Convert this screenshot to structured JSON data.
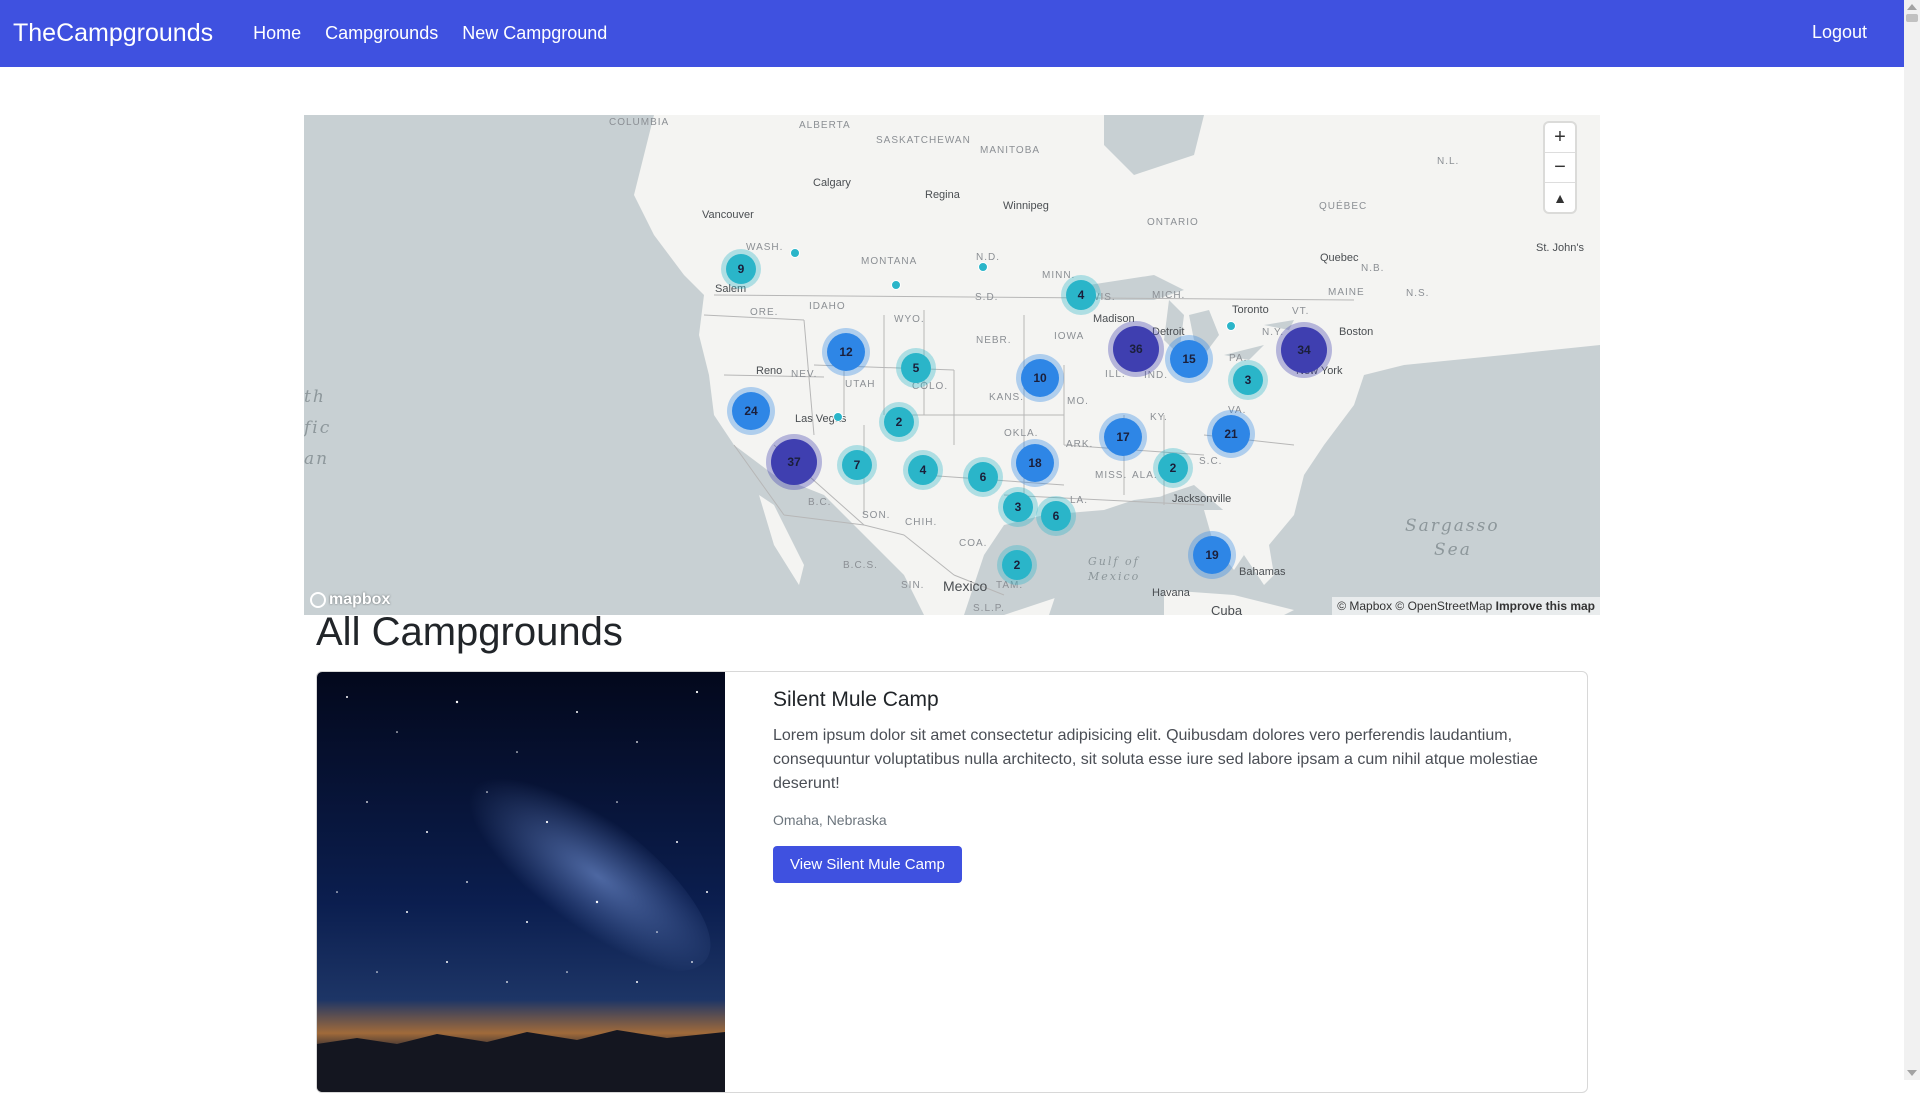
{
  "nav": {
    "brand": "TheCampgrounds",
    "links": [
      "Home",
      "Campgrounds",
      "New Campground"
    ],
    "logout": "Logout"
  },
  "map": {
    "region_labels": [
      "COLUMBIA",
      "ALBERTA",
      "SASKATCHEWAN",
      "MANITOBA",
      "ONTARIO",
      "QUÉBEC",
      "N.L.",
      "WASH.",
      "MONTANA",
      "N.D.",
      "MINN.",
      "ORE.",
      "IDAHO",
      "WYO.",
      "S.D.",
      "WIS.",
      "MICH.",
      "NEBR.",
      "IOWA",
      "NEV.",
      "UTAH",
      "COLO.",
      "KANS.",
      "MO.",
      "ILL.",
      "IND.",
      "PA.",
      "N.Y.",
      "VT.",
      "MAINE",
      "N.B.",
      "N.S.",
      "OKLA.",
      "ARK.",
      "KY.",
      "VA.",
      "MISS.",
      "ALA.",
      "S.C.",
      "LA.",
      "SON.",
      "CHIH.",
      "COA.",
      "B.C.",
      "B.C.S.",
      "SIN.",
      "TAM.",
      "S.L.P."
    ],
    "city_labels": [
      "Calgary",
      "Regina",
      "Winnipeg",
      "Vancouver",
      "Salem",
      "Quebec",
      "St. John's",
      "Toronto",
      "Detroit",
      "Madison",
      "Boston",
      "New York",
      "Reno",
      "Las Vegas",
      "Jacksonville",
      "Bahamas",
      "Havana",
      "Cuba",
      "Mexico"
    ],
    "ocean_labels": [
      "th",
      "fic",
      "an",
      "Sargasso",
      "Sea",
      "Gulf of",
      "Mexico"
    ],
    "clusters": [
      "9",
      "4",
      "12",
      "5",
      "36",
      "15",
      "34",
      "10",
      "3",
      "24",
      "2",
      "17",
      "21",
      "37",
      "7",
      "4",
      "6",
      "18",
      "2",
      "3",
      "6",
      "2",
      "19"
    ],
    "controls": {
      "zoom_in": "+",
      "zoom_out": "−",
      "compass": "▲"
    },
    "logo_text": "mapbox",
    "attribution": {
      "text": "© Mapbox © OpenStreetMap",
      "link": "Improve this map"
    }
  },
  "page": {
    "title": "All Campgrounds"
  },
  "campground": {
    "title": "Silent Mule Camp",
    "description": "Lorem ipsum dolor sit amet consectetur adipisicing elit. Quibusdam dolores vero perferendis laudantium, consequuntur voluptatibus nulla architecto, sit soluta esse iure sed labore ipsam a cum nihil atque molestiae deserunt!",
    "location": "Omaha, Nebraska",
    "button": "View Silent Mule Camp"
  },
  "colors": {
    "accent": "#3f51e0",
    "cluster_small": "#2ab5c9",
    "cluster_medium": "#2e86e6",
    "cluster_large": "#3f3fb0"
  }
}
